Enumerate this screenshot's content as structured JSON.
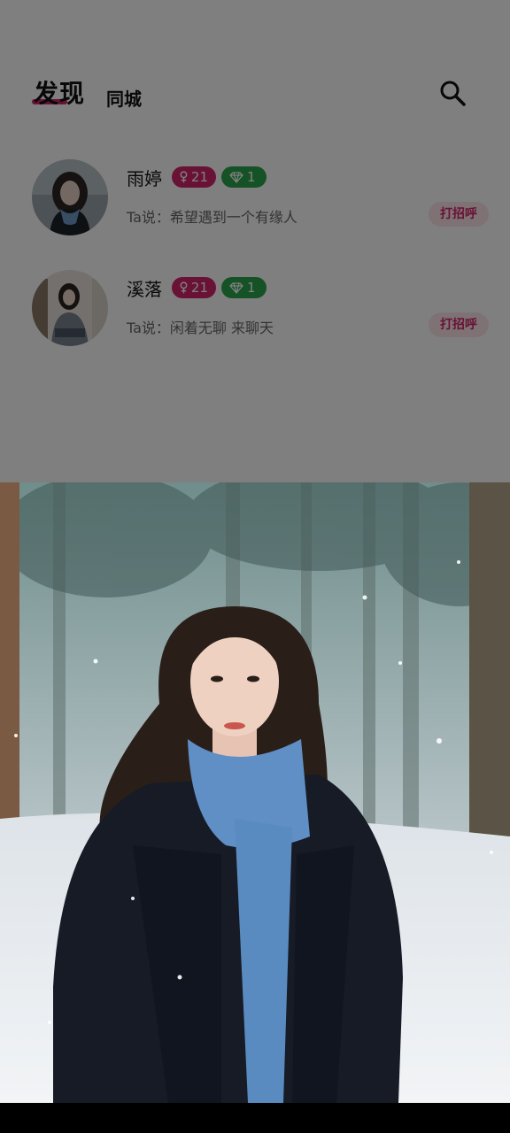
{
  "header": {
    "tabs": [
      {
        "label": "发现"
      },
      {
        "label": "同城"
      }
    ],
    "search_icon": "search-icon"
  },
  "users": [
    {
      "name": "雨婷",
      "age": "21",
      "gender_icon": "female-icon",
      "vip_level": "1",
      "vip_icon": "diamond-icon",
      "bio": "Ta说：希望遇到一个有缘人",
      "action": "打招呼"
    },
    {
      "name": "溪落",
      "age": "21",
      "gender_icon": "female-icon",
      "vip_level": "1",
      "vip_icon": "diamond-icon",
      "bio": "Ta说：闲着无聊 来聊天",
      "action": "打招呼"
    }
  ],
  "colors": {
    "accent": "#d2256a",
    "vip": "#2aa54a",
    "overlay": "rgba(0,0,0,0.5)"
  },
  "popup": {
    "image": "woman-in-snowy-forest-photo"
  }
}
